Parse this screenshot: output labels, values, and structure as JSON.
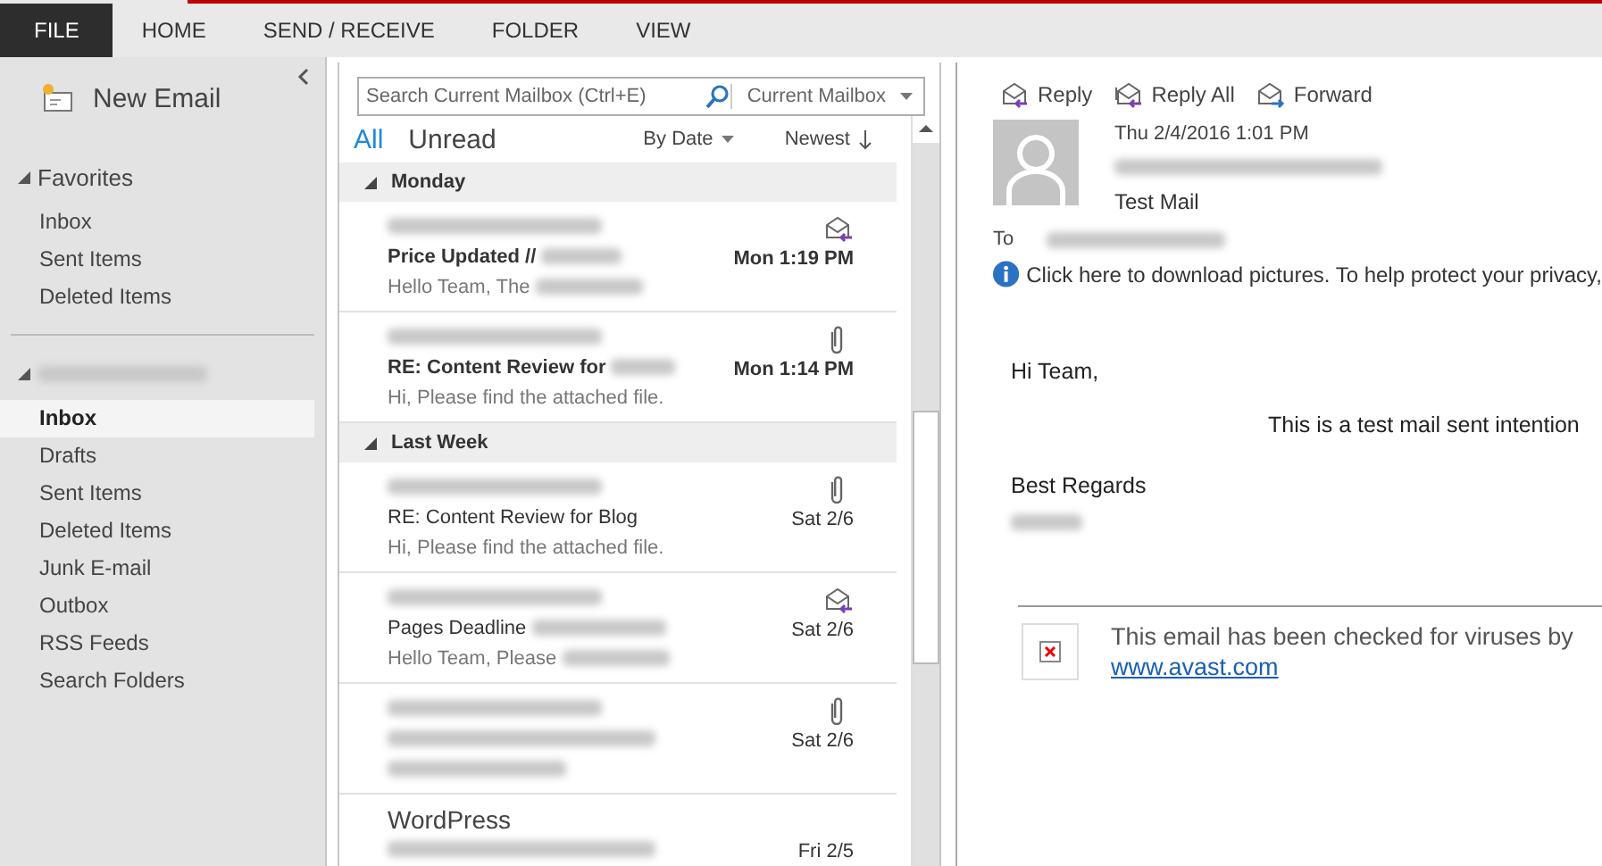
{
  "ribbon": {
    "tabs": [
      {
        "label": "FILE",
        "selected": true
      },
      {
        "label": "HOME",
        "selected": false
      },
      {
        "label": "SEND / RECEIVE",
        "selected": false
      },
      {
        "label": "FOLDER",
        "selected": false
      },
      {
        "label": "VIEW",
        "selected": false
      }
    ]
  },
  "nav": {
    "new_email": "New Email",
    "favorites": {
      "label": "Favorites",
      "expanded": true,
      "items": [
        {
          "label": "Inbox",
          "selected": false
        },
        {
          "label": "Sent Items",
          "selected": false
        },
        {
          "label": "Deleted Items",
          "selected": false
        }
      ]
    },
    "account": {
      "expanded": true,
      "items": [
        {
          "label": "Inbox",
          "selected": true
        },
        {
          "label": "Drafts",
          "selected": false
        },
        {
          "label": "Sent Items",
          "selected": false
        },
        {
          "label": "Deleted Items",
          "selected": false
        },
        {
          "label": "Junk E-mail",
          "selected": false
        },
        {
          "label": "Outbox",
          "selected": false
        },
        {
          "label": "RSS Feeds",
          "selected": false
        },
        {
          "label": "Search Folders",
          "selected": false
        }
      ]
    }
  },
  "mail_list": {
    "search": {
      "placeholder": "Search Current Mailbox (Ctrl+E)"
    },
    "scope": "Current Mailbox",
    "filters": [
      {
        "label": "All",
        "selected": true
      },
      {
        "label": "Unread",
        "selected": false
      }
    ],
    "sort": "By Date",
    "order": "Newest",
    "groups": [
      {
        "label": "Monday",
        "expanded": true,
        "messages": [
          {
            "subject": "Price Updated //",
            "preview": "Hello Team,  The",
            "time": "Mon 1:19 PM",
            "kind": "replied",
            "unread": true
          },
          {
            "subject": "RE: Content Review for",
            "preview": "Hi,  Please find the attached file.",
            "time": "Mon 1:14 PM",
            "kind": "attachment",
            "unread": true
          }
        ]
      },
      {
        "label": "Last Week",
        "expanded": true,
        "messages": [
          {
            "subject": "RE: Content Review for Blog",
            "preview": "Hi,  Please find the attached file.",
            "time": "Sat 2/6",
            "kind": "attachment",
            "unread": false
          },
          {
            "subject": "Pages Deadline",
            "preview": "Hello Team,  Please",
            "time": "Sat 2/6",
            "kind": "replied",
            "unread": false
          },
          {
            "time": "Sat 2/6",
            "kind": "attachment",
            "unread": false
          },
          {
            "sender": "WordPress",
            "time": "Fri 2/5",
            "kind": "plain",
            "unread": false
          }
        ]
      }
    ]
  },
  "reading": {
    "actions": [
      {
        "label": "Reply",
        "kind": "reply"
      },
      {
        "label": "Reply All",
        "kind": "reply_all"
      },
      {
        "label": "Forward",
        "kind": "forward"
      }
    ],
    "date": "Thu 2/4/2016 1:01 PM",
    "subject": "Test Mail",
    "to_label": "To",
    "info": "Click here to download pictures. To help protect your privacy,",
    "body": {
      "greeting": "Hi Team,",
      "message": "This is a test mail sent intention",
      "closing": "Best Regards"
    },
    "footer": {
      "text": "This email has been checked for viruses by",
      "link": "www.avast.com"
    }
  }
}
